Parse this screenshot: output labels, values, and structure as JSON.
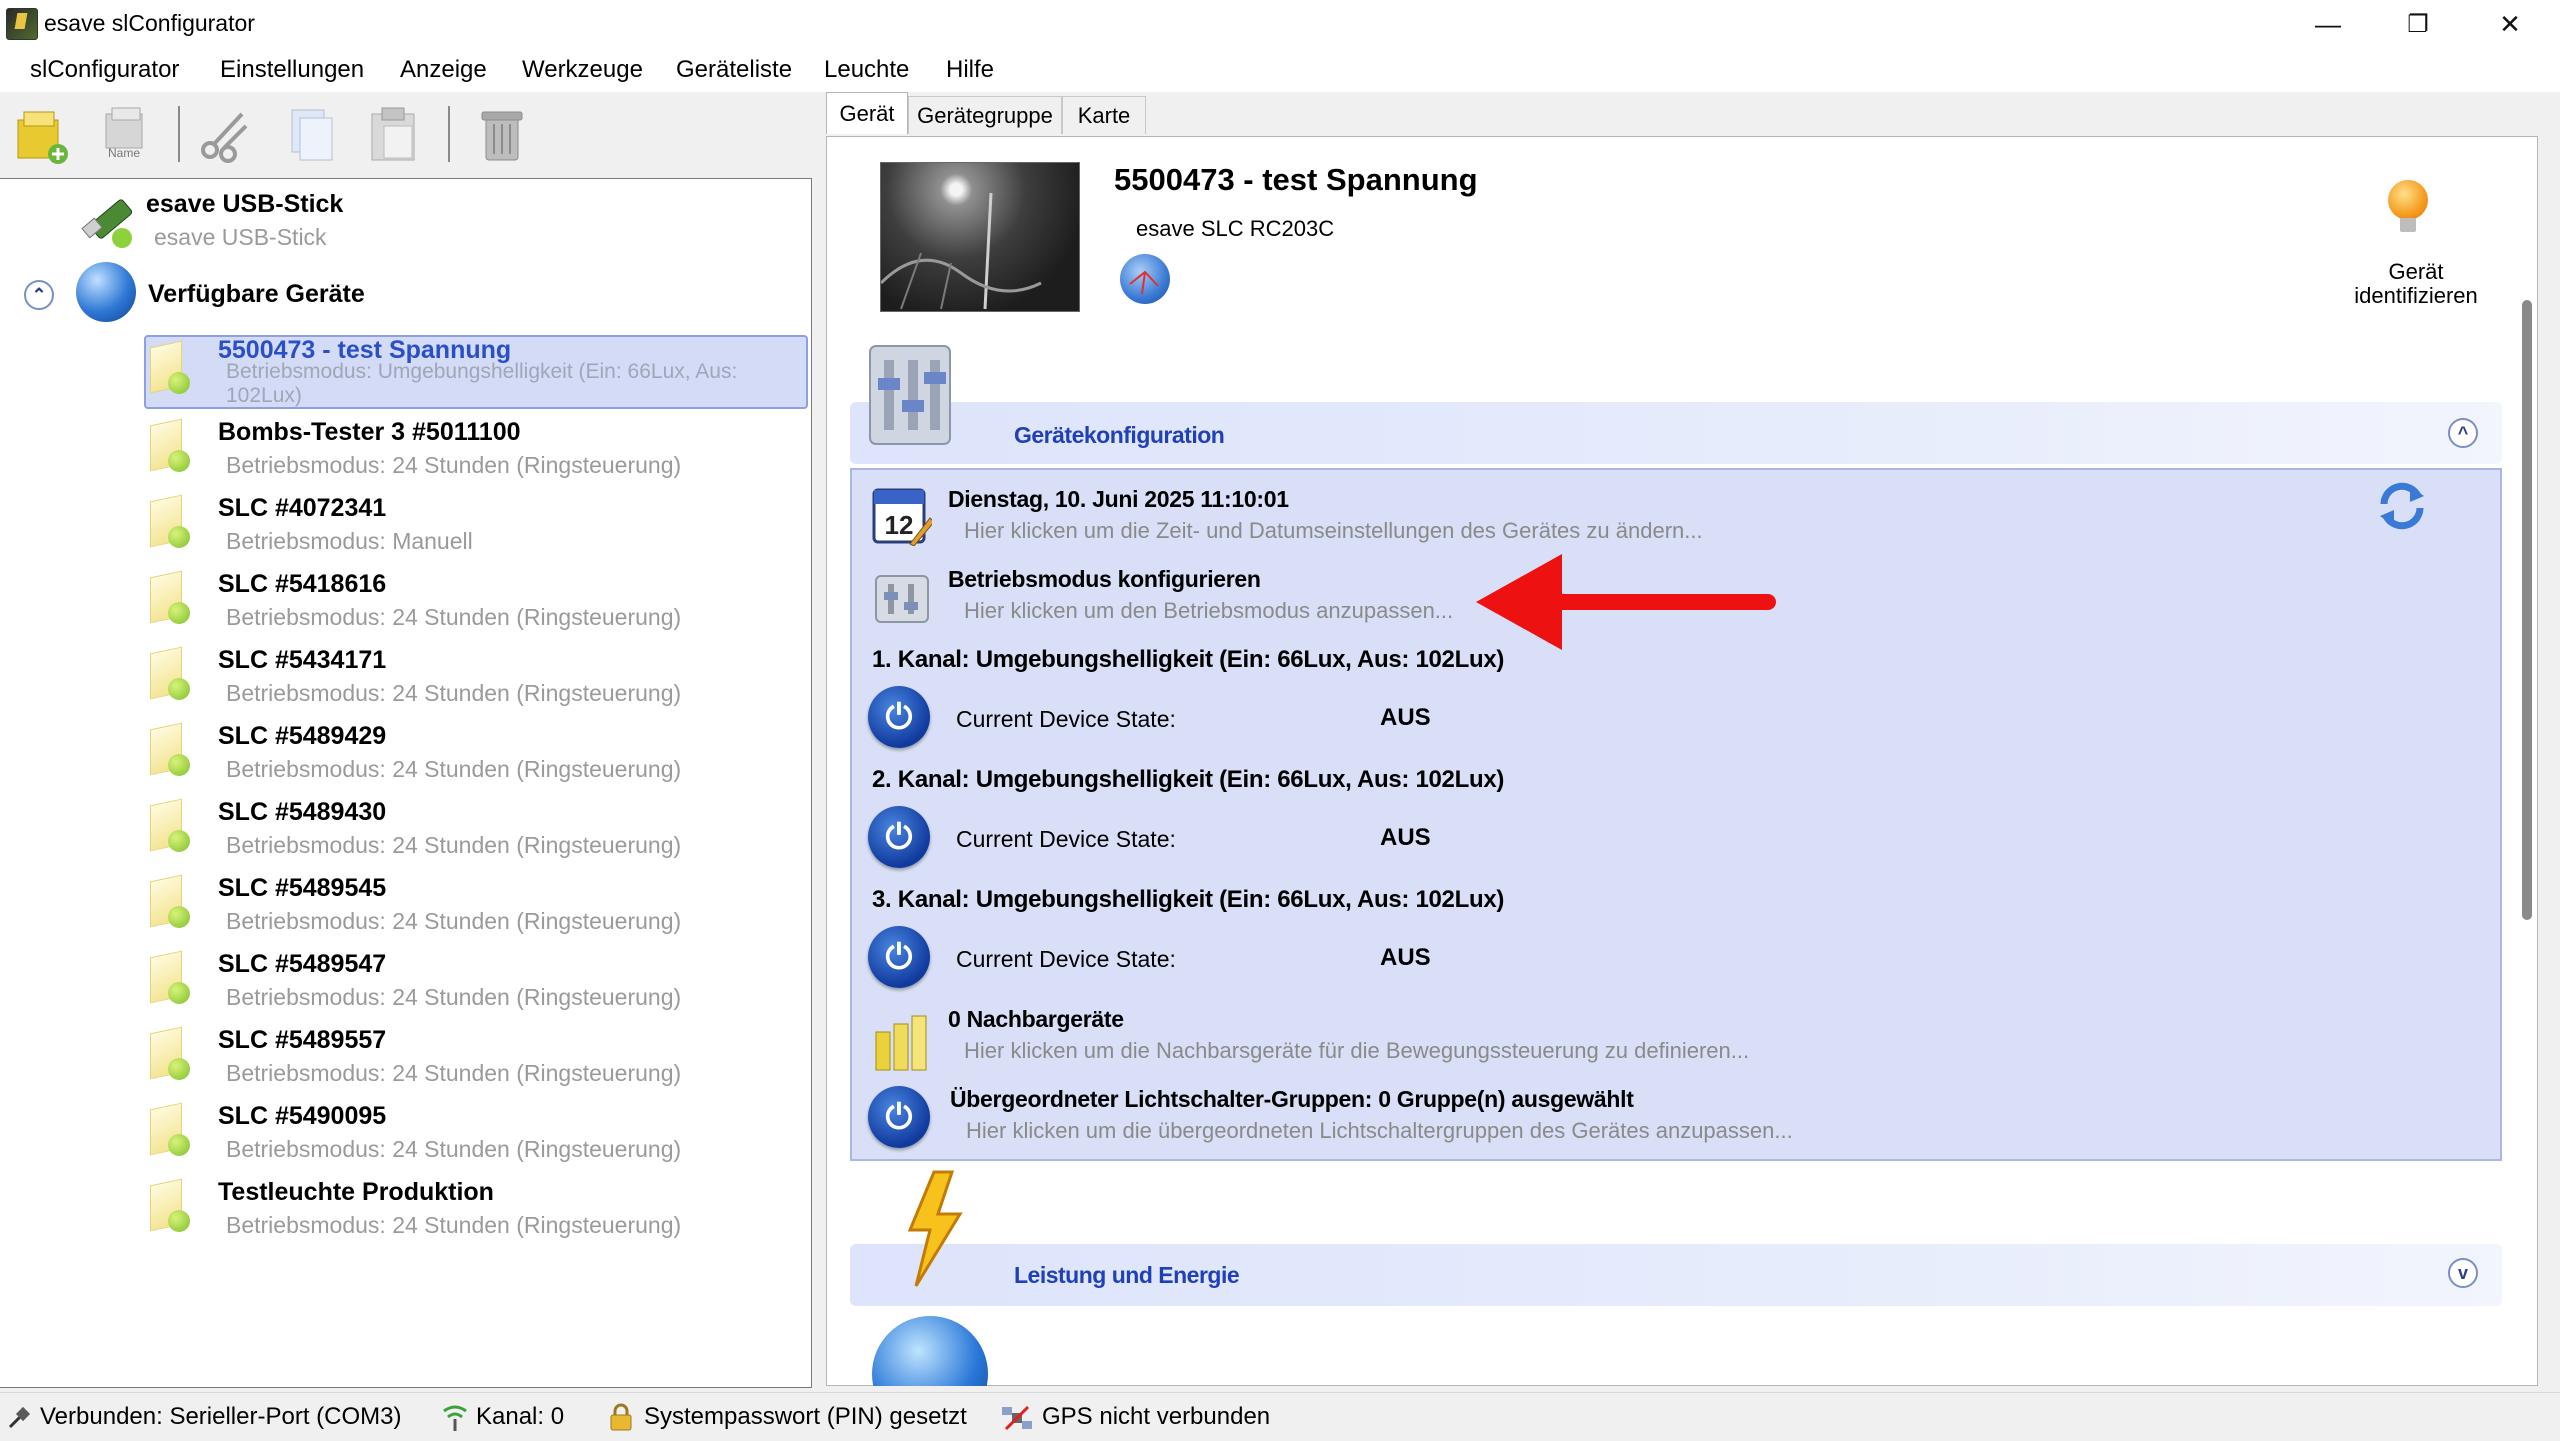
{
  "window": {
    "title": "esave slConfigurator",
    "controls": {
      "minimize": "—",
      "maximize": "❐",
      "close": "✕"
    }
  },
  "menu": [
    "slConfigurator",
    "Einstellungen",
    "Anzeige",
    "Werkzeuge",
    "Geräteliste",
    "Leuchte",
    "Hilfe"
  ],
  "toolbar": {
    "buttons": [
      {
        "name": "add-device",
        "icon": "folder-add-icon"
      },
      {
        "name": "rename",
        "icon": "rename-icon",
        "label": "Name"
      },
      {
        "name": "cut",
        "icon": "scissors-icon"
      },
      {
        "name": "copy",
        "icon": "copy-icon"
      },
      {
        "name": "paste",
        "icon": "paste-icon"
      },
      {
        "name": "delete",
        "icon": "trash-icon"
      }
    ]
  },
  "tree": {
    "usb": {
      "title": "esave USB-Stick",
      "subtitle": "esave USB-Stick"
    },
    "available": {
      "title": "Verfügbare Geräte",
      "toggle": "⌃"
    },
    "devices": [
      {
        "title": "5500473 - test  Spannung",
        "subtitle": "Betriebsmodus: Umgebungshelligkeit (Ein: 66Lux, Aus: 102Lux)",
        "selected": true
      },
      {
        "title": "Bombs-Tester 3 #5011100",
        "subtitle": "Betriebsmodus: 24 Stunden (Ringsteuerung)"
      },
      {
        "title": "SLC #4072341",
        "subtitle": "Betriebsmodus: Manuell"
      },
      {
        "title": "SLC #5418616",
        "subtitle": "Betriebsmodus: 24 Stunden (Ringsteuerung)"
      },
      {
        "title": "SLC #5434171",
        "subtitle": "Betriebsmodus: 24 Stunden (Ringsteuerung)"
      },
      {
        "title": "SLC #5489429",
        "subtitle": "Betriebsmodus: 24 Stunden (Ringsteuerung)"
      },
      {
        "title": "SLC #5489430",
        "subtitle": "Betriebsmodus: 24 Stunden (Ringsteuerung)"
      },
      {
        "title": "SLC #5489545",
        "subtitle": "Betriebsmodus: 24 Stunden (Ringsteuerung)"
      },
      {
        "title": "SLC #5489547",
        "subtitle": "Betriebsmodus: 24 Stunden (Ringsteuerung)"
      },
      {
        "title": "SLC #5489557",
        "subtitle": "Betriebsmodus: 24 Stunden (Ringsteuerung)"
      },
      {
        "title": "SLC #5490095",
        "subtitle": "Betriebsmodus: 24 Stunden (Ringsteuerung)"
      },
      {
        "title": "Testleuchte Produktion",
        "subtitle": "Betriebsmodus: 24 Stunden (Ringsteuerung)"
      }
    ]
  },
  "tabs": [
    "Gerät",
    "Gerätegruppe",
    "Karte"
  ],
  "device": {
    "name": "5500473 - test  Spannung",
    "model": "esave SLC RC203C",
    "identify_line1": "Gerät",
    "identify_line2": "identifizieren"
  },
  "config": {
    "section_title": "Gerätekonfiguration",
    "datetime": {
      "title": "Dienstag, 10. Juni 2025 11:10:01",
      "subtitle": "Hier klicken um die Zeit- und Datumseinstellungen des Gerätes zu ändern...",
      "calendar_day": "12"
    },
    "mode": {
      "title": "Betriebsmodus konfigurieren",
      "subtitle": "Hier klicken um den Betriebsmodus anzupassen..."
    },
    "channels": [
      {
        "title": "1. Kanal: Umgebungshelligkeit (Ein: 66Lux, Aus: 102Lux)",
        "state_label": "Current Device State:",
        "state": "AUS"
      },
      {
        "title": "2. Kanal: Umgebungshelligkeit (Ein: 66Lux, Aus: 102Lux)",
        "state_label": "Current Device State:",
        "state": "AUS"
      },
      {
        "title": "3. Kanal: Umgebungshelligkeit (Ein: 66Lux, Aus: 102Lux)",
        "state_label": "Current Device State:",
        "state": "AUS"
      }
    ],
    "neighbors": {
      "title": "0 Nachbargeräte",
      "subtitle": "Hier klicken um die Nachbarsgeräte für die Bewegungssteuerung zu definieren..."
    },
    "groups": {
      "title": "Übergeordneter Lichtschalter-Gruppen: 0 Gruppe(n) ausgewählt",
      "subtitle": "Hier klicken um die übergeordneten Lichtschaltergruppen des Gerätes anzupassen..."
    }
  },
  "energy": {
    "section_title": "Leistung und Energie"
  },
  "status": {
    "connection": "Verbunden: Serieller-Port (COM3)",
    "channel": "Kanal: 0",
    "password": "Systempasswort (PIN) gesetzt",
    "gps": "GPS nicht verbunden"
  },
  "colors": {
    "accent": "#2040b8",
    "arrow": "#ee1111",
    "config_bg": "#d8dff6",
    "selection": "#d4dbf6"
  }
}
